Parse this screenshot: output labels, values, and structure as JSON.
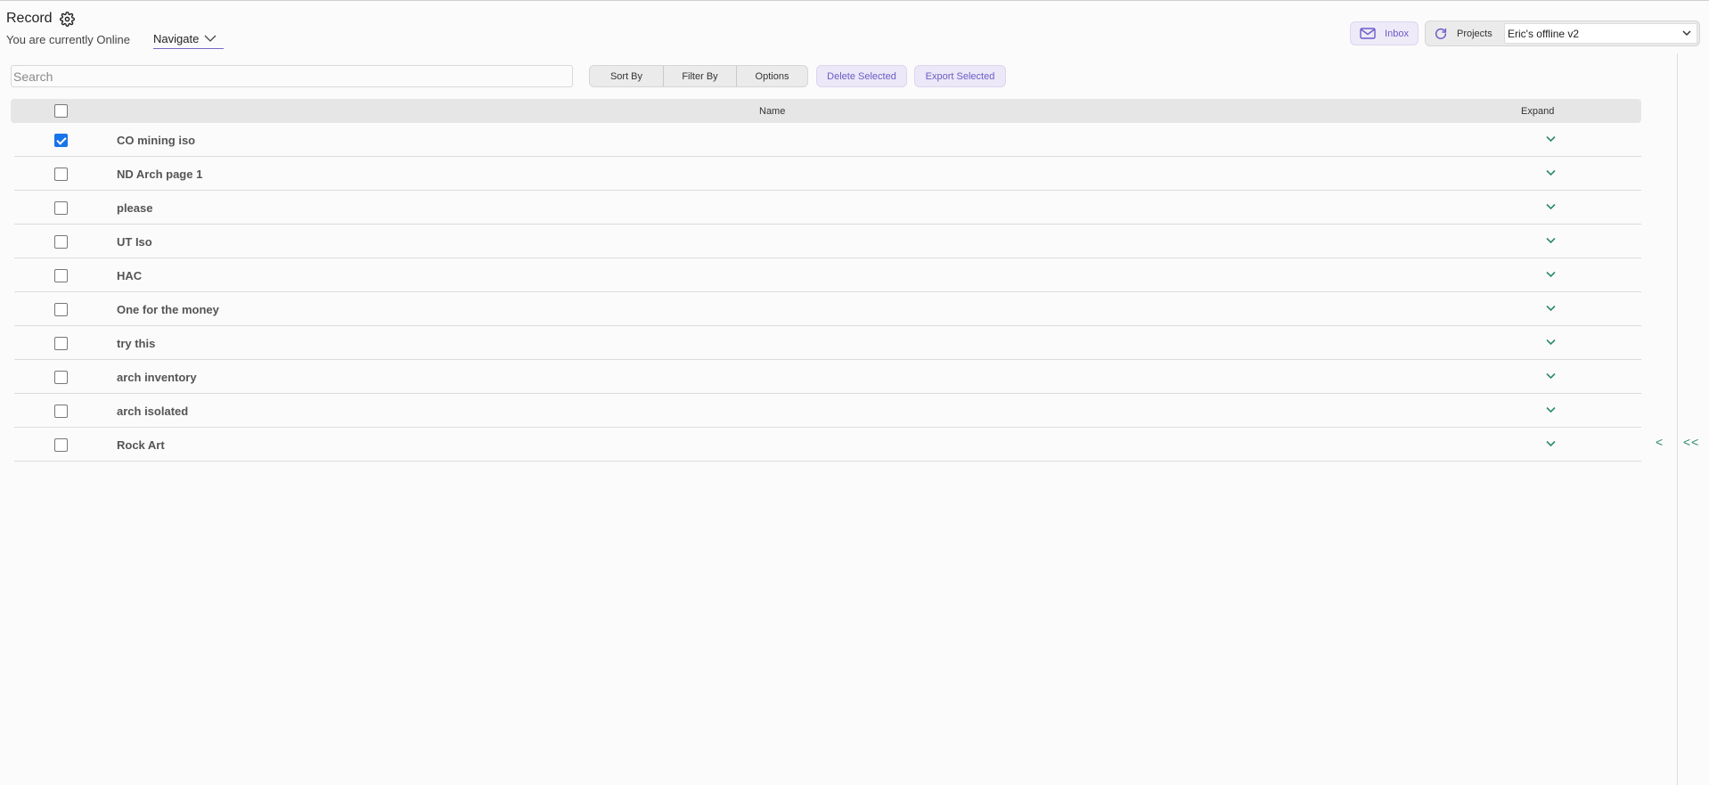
{
  "header": {
    "title": "Record",
    "status": "You are currently Online",
    "navigate_label": "Navigate",
    "inbox_label": "Inbox",
    "projects_label": "Projects",
    "project_selected": "Eric's offline v2"
  },
  "toolbar": {
    "search_placeholder": "Search",
    "sort_label": "Sort By",
    "filter_label": "Filter By",
    "options_label": "Options",
    "delete_label": "Delete Selected",
    "export_label": "Export Selected"
  },
  "table": {
    "columns": [
      "Name",
      "Expand"
    ],
    "rows": [
      {
        "name": "CO mining iso",
        "checked": true
      },
      {
        "name": "ND Arch page 1",
        "checked": false
      },
      {
        "name": "please",
        "checked": false
      },
      {
        "name": "UT Iso",
        "checked": false
      },
      {
        "name": "HAC",
        "checked": false
      },
      {
        "name": "One for the money",
        "checked": false
      },
      {
        "name": "try this",
        "checked": false
      },
      {
        "name": "arch inventory",
        "checked": false
      },
      {
        "name": "arch isolated",
        "checked": false
      },
      {
        "name": "Rock Art",
        "checked": false
      }
    ]
  },
  "pager": {
    "prev": "<",
    "first": "<<"
  },
  "icons": {
    "settings": "gear-icon",
    "navigate": "chevron-down-icon",
    "inbox": "mail-icon",
    "projects": "refresh-icon",
    "row_expand": "chevron-down-icon"
  },
  "colors": {
    "accent_purple": "#6a5bc8",
    "expand_green": "#2d8a6b",
    "checkbox_blue": "#1a73e8"
  }
}
